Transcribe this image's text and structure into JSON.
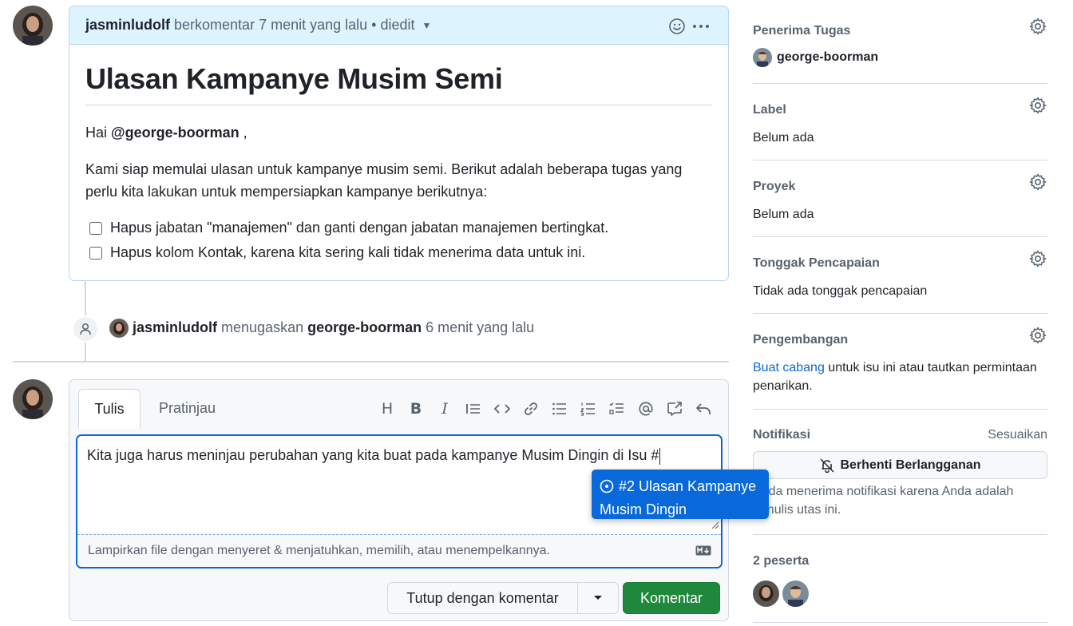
{
  "comment": {
    "author": "jasminludolf",
    "meta": "berkomentar 7 menit yang lalu • diedit",
    "title": "Ulasan Kampanye Musim Semi",
    "greeting_prefix": "Hai ",
    "mention": "@george-boorman",
    "greeting_suffix": " ,",
    "paragraph": "Kami siap memulai ulasan untuk kampanye musim semi. Berikut adalah beberapa tugas yang perlu kita lakukan untuk mempersiapkan kampanye berikutnya:",
    "tasks": [
      "Hapus jabatan \"manajemen\" dan ganti dengan jabatan manajemen bertingkat.",
      "Hapus kolom Kontak, karena kita sering kali tidak menerima data untuk ini."
    ]
  },
  "timeline_event": {
    "actor": "jasminludolf",
    "action": " menugaskan ",
    "target": "george-boorman",
    "time": " 6 menit yang lalu"
  },
  "editor": {
    "tab_write": "Tulis",
    "tab_preview": "Pratinjau",
    "toolbar_heading": "H",
    "toolbar_bold": "B",
    "toolbar_italic": "I",
    "text": "Kita juga harus meninjau perubahan yang kita buat pada kampanye Musim Dingin di Isu #",
    "attach_hint": "Lampirkan file dengan menyeret & menjatuhkan, memilih, atau menempelkannya.",
    "suggestion_line1": "#2 Ulasan Kampanye",
    "suggestion_line2": "Musim Dingin",
    "close_button": "Tutup dengan komentar",
    "comment_button": "Komentar"
  },
  "sidebar": {
    "assignees": {
      "label": "Penerima Tugas",
      "value": "george-boorman"
    },
    "labels": {
      "label": "Label",
      "value": "Belum ada"
    },
    "projects": {
      "label": "Proyek",
      "value": "Belum ada"
    },
    "milestone": {
      "label": "Tonggak Pencapaian",
      "value": "Tidak ada tonggak pencapaian"
    },
    "development": {
      "label": "Pengembangan",
      "link": "Buat cabang",
      "text": " untuk isu ini atau tautkan permintaan penarikan."
    },
    "notifications": {
      "label": "Notifikasi",
      "customize": "Sesuaikan",
      "unsubscribe": "Berhenti Berlangganan",
      "description": "Anda menerima notifikasi karena Anda adalah penulis utas ini."
    },
    "participants": {
      "label": "2 peserta"
    }
  },
  "colors": {
    "accent": "#0969da",
    "header_bg": "#ddf4ff",
    "success": "#1f883d"
  }
}
